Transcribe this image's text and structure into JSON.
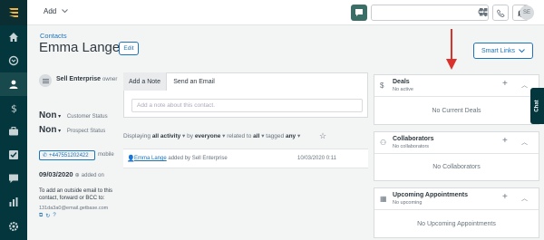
{
  "topbar": {
    "add_label": "Add",
    "search_placeholder": ""
  },
  "nav": {
    "items": [
      "home",
      "deals",
      "contacts",
      "money",
      "briefcase",
      "tasks",
      "chat",
      "reports",
      "settings"
    ]
  },
  "header": {
    "breadcrumb": "Contacts",
    "contact_name": "Emma Lange",
    "edit_label": "Edit",
    "smart_links_label": "Smart Links"
  },
  "sidebar": {
    "owner_name": "Sell Enterprise",
    "owner_label": "owner",
    "customer_status_value": "Non",
    "customer_status_label": "Customer Status",
    "prospect_status_value": "Non",
    "prospect_status_label": "Prospect Status",
    "phone": "+447551202422",
    "phone_type": "mobile",
    "added_date": "09/03/2020",
    "added_label": "added on",
    "bcc_text": "To add an outside email to this contact, forward or BCC to:",
    "bcc_email": "131da3a0@email.getbase.com"
  },
  "notes": {
    "tab_note": "Add a Note",
    "tab_email": "Send an Email",
    "note_placeholder": "Add a note about this contact."
  },
  "filters": {
    "displaying": "Displaying",
    "activity": "all activity",
    "by": "by",
    "everyone": "everyone",
    "related_to": "related to",
    "all": "all",
    "tagged": "tagged",
    "any": "any"
  },
  "activity": {
    "person": "Emma Lange",
    "text": "added by Sell Enterprise",
    "date": "10/03/2020 0:11"
  },
  "cards": {
    "deals": {
      "title": "Deals",
      "sub": "No active",
      "empty": "No Current Deals"
    },
    "collaborators": {
      "title": "Collaborators",
      "sub": "No collaborators",
      "empty": "No Collaborators"
    },
    "appointments": {
      "title": "Upcoming Appointments",
      "sub": "No upcoming",
      "empty": "No Upcoming Appointments"
    }
  },
  "chat_tab": "Chat",
  "colors": {
    "nav_bg": "#03363d",
    "link": "#1f73b7",
    "arrow": "#d9312b"
  }
}
